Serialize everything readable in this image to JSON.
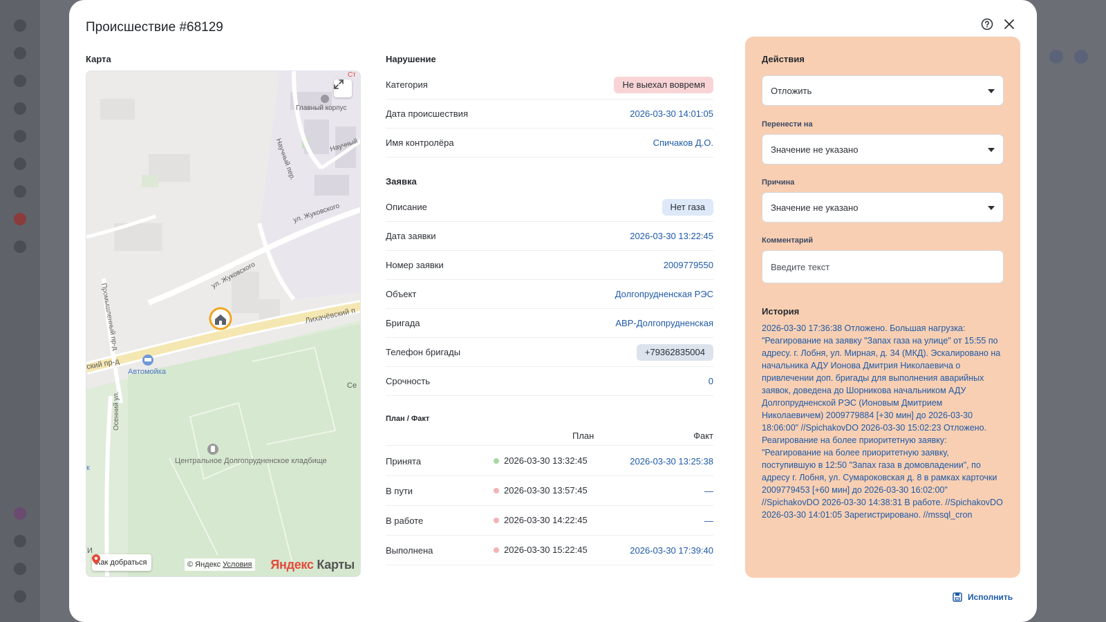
{
  "modal": {
    "title": "Происшествие #68129"
  },
  "map": {
    "label": "Карта",
    "places": {
      "main_building": "Главный корпус",
      "nauchny_per": "Научный пер.",
      "nauchny": "Научный",
      "zhukovskogo_1": "ул. Жуковского",
      "zhukovskogo_2": "ул. Жуковского",
      "likhachevsky": "Лихачёвский п",
      "promyshlenny": "Промышленный пр-д",
      "sky_prd": "ский пр-д",
      "car_wash": "Автомойка",
      "osenny": "Осенний ул.",
      "cemetery": "Центральное Долгопрудненское кладбище",
      "se": "Се",
      "st": "Ст",
      "k": "к",
      "i": "И"
    },
    "route_button": "Как добраться",
    "copyright": "© Яндекс",
    "terms_link": "Условия",
    "brand_a": "Яндекс",
    "brand_b": " Карты"
  },
  "violation": {
    "label": "Нарушение",
    "rows": {
      "category": {
        "key": "Категория",
        "value": "Не выехал вовремя"
      },
      "incident_date": {
        "key": "Дата происшествия",
        "value": "2026-03-30 14:01:05"
      },
      "controller": {
        "key": "Имя контролёра",
        "value": "Спичаков Д.О."
      }
    }
  },
  "request": {
    "label": "Заявка",
    "rows": {
      "description": {
        "key": "Описание",
        "value": "Нет газа"
      },
      "request_date": {
        "key": "Дата заявки",
        "value": "2026-03-30 13:22:45"
      },
      "request_number": {
        "key": "Номер заявки",
        "value": "2009779550"
      },
      "object": {
        "key": "Объект",
        "value": "Долгопрудненская РЭС"
      },
      "brigade": {
        "key": "Бригада",
        "value": "АВР-Долгопрудненская"
      },
      "brigade_phone": {
        "key": "Телефон бригады",
        "value": "+79362835004"
      },
      "urgency": {
        "key": "Срочность",
        "value": "0"
      }
    }
  },
  "plan_fact": {
    "label": "План / Факт",
    "col_plan": "План",
    "col_fact": "Факт",
    "rows": [
      {
        "stage": "Принята",
        "plan": "2026-03-30 13:32:45",
        "fact": "2026-03-30 13:25:38",
        "status_color": "#a7d9a1"
      },
      {
        "stage": "В пути",
        "plan": "2026-03-30 13:57:45",
        "fact": "—",
        "status_color": "#f4b2b6"
      },
      {
        "stage": "В работе",
        "plan": "2026-03-30 14:22:45",
        "fact": "—",
        "status_color": "#f4b2b6"
      },
      {
        "stage": "Выполнена",
        "plan": "2026-03-30 15:22:45",
        "fact": "2026-03-30 17:39:40",
        "status_color": "#f4b2b6"
      }
    ]
  },
  "actions": {
    "label": "Действия",
    "action_value": "Отложить",
    "postpone_label": "Перенести на",
    "postpone_value": "Значение не указано",
    "reason_label": "Причина",
    "reason_value": "Значение не указано",
    "comment_label": "Комментарий",
    "comment_placeholder": "Введите текст",
    "history_label": "История",
    "history_text": "2026-03-30 17:36:38 Отложено. Большая нагрузка: \"Реагирование на заявку \"Запах газа на улице\" от 15:55 по адресу. г. Лобня, ул. Мирная, д. 34 (МКД). Эскалировано на начальника АДУ Ионова Дмитрия Николаевича о привлечении доп. бригады для выполнения аварийных заявок, доведена до Шорникова начальником АДУ Долгопрудненской РЭС (Ионовым Дмитрием Николаевичем) 2009779884 [+30 мин] до 2026-03-30 18:06:00\" //SpichakovDO 2026-03-30 15:02:23 Отложено. Реагирование на более приоритетную заявку: \"Реагирование на более приоритетную заявку, поступившую в 12:50 \"Запах газа в домовладении\", по адресу г. Лобня, ул. Сумароковская д. 8 в рамках карточки 2009779453 [+60 мин] до 2026-03-30 16:02:00\" //SpichakovDO 2026-03-30 14:38:31 В работе. //SpichakovDO 2026-03-30 14:01:05 Зарегистрировано. //mssql_cron"
  },
  "footer": {
    "submit_label": "Исполнить"
  },
  "colors": {
    "accent": "#1e5aa8",
    "actions_panel": "#f8cfb2",
    "badge_red": "#f9d4d6",
    "badge_blue": "#dde8f8"
  },
  "icons": [
    "help-icon",
    "close-icon",
    "expand-icon",
    "home-marker-icon",
    "car-wash-icon",
    "cemetery-icon",
    "location-pin-icon",
    "save-icon",
    "chevron-down-icon"
  ]
}
